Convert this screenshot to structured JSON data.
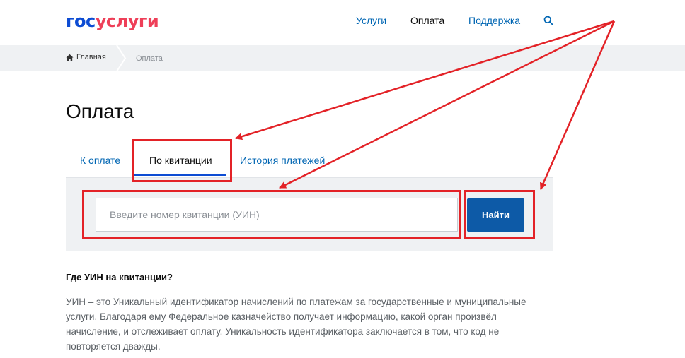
{
  "header": {
    "logo_part1": "гос",
    "logo_part2": "услуги",
    "nav": {
      "services": "Услуги",
      "payment": "Оплата",
      "support": "Поддержка"
    },
    "search_icon": "search-icon"
  },
  "breadcrumb": {
    "home": "Главная",
    "current": "Оплата",
    "home_icon": "home-icon"
  },
  "page": {
    "title": "Оплата"
  },
  "tabs": [
    {
      "label": "К оплате",
      "active": false
    },
    {
      "label": "По квитанции",
      "active": true
    },
    {
      "label": "История платежей",
      "active": false
    }
  ],
  "search": {
    "placeholder": "Введите номер квитанции (УИН)",
    "value": "",
    "button_label": "Найти"
  },
  "info": {
    "heading": "Где УИН на квитанции?",
    "text": "УИН – это Уникальный идентификатор начислений по платежам за государственные и муниципальные услуги. Благодаря ему Федеральное казначейство получает информацию, какой орган произвёл начисление, и отслеживает оплату. Уникальность идентификатора заключается в том, что код не повторяется дважды."
  },
  "colors": {
    "brand_blue": "#0d4cd3",
    "brand_red": "#ee3f58",
    "link": "#0066b3",
    "button": "#0d5aa7",
    "annotation": "#e32227",
    "panel_bg": "#eff1f3"
  }
}
